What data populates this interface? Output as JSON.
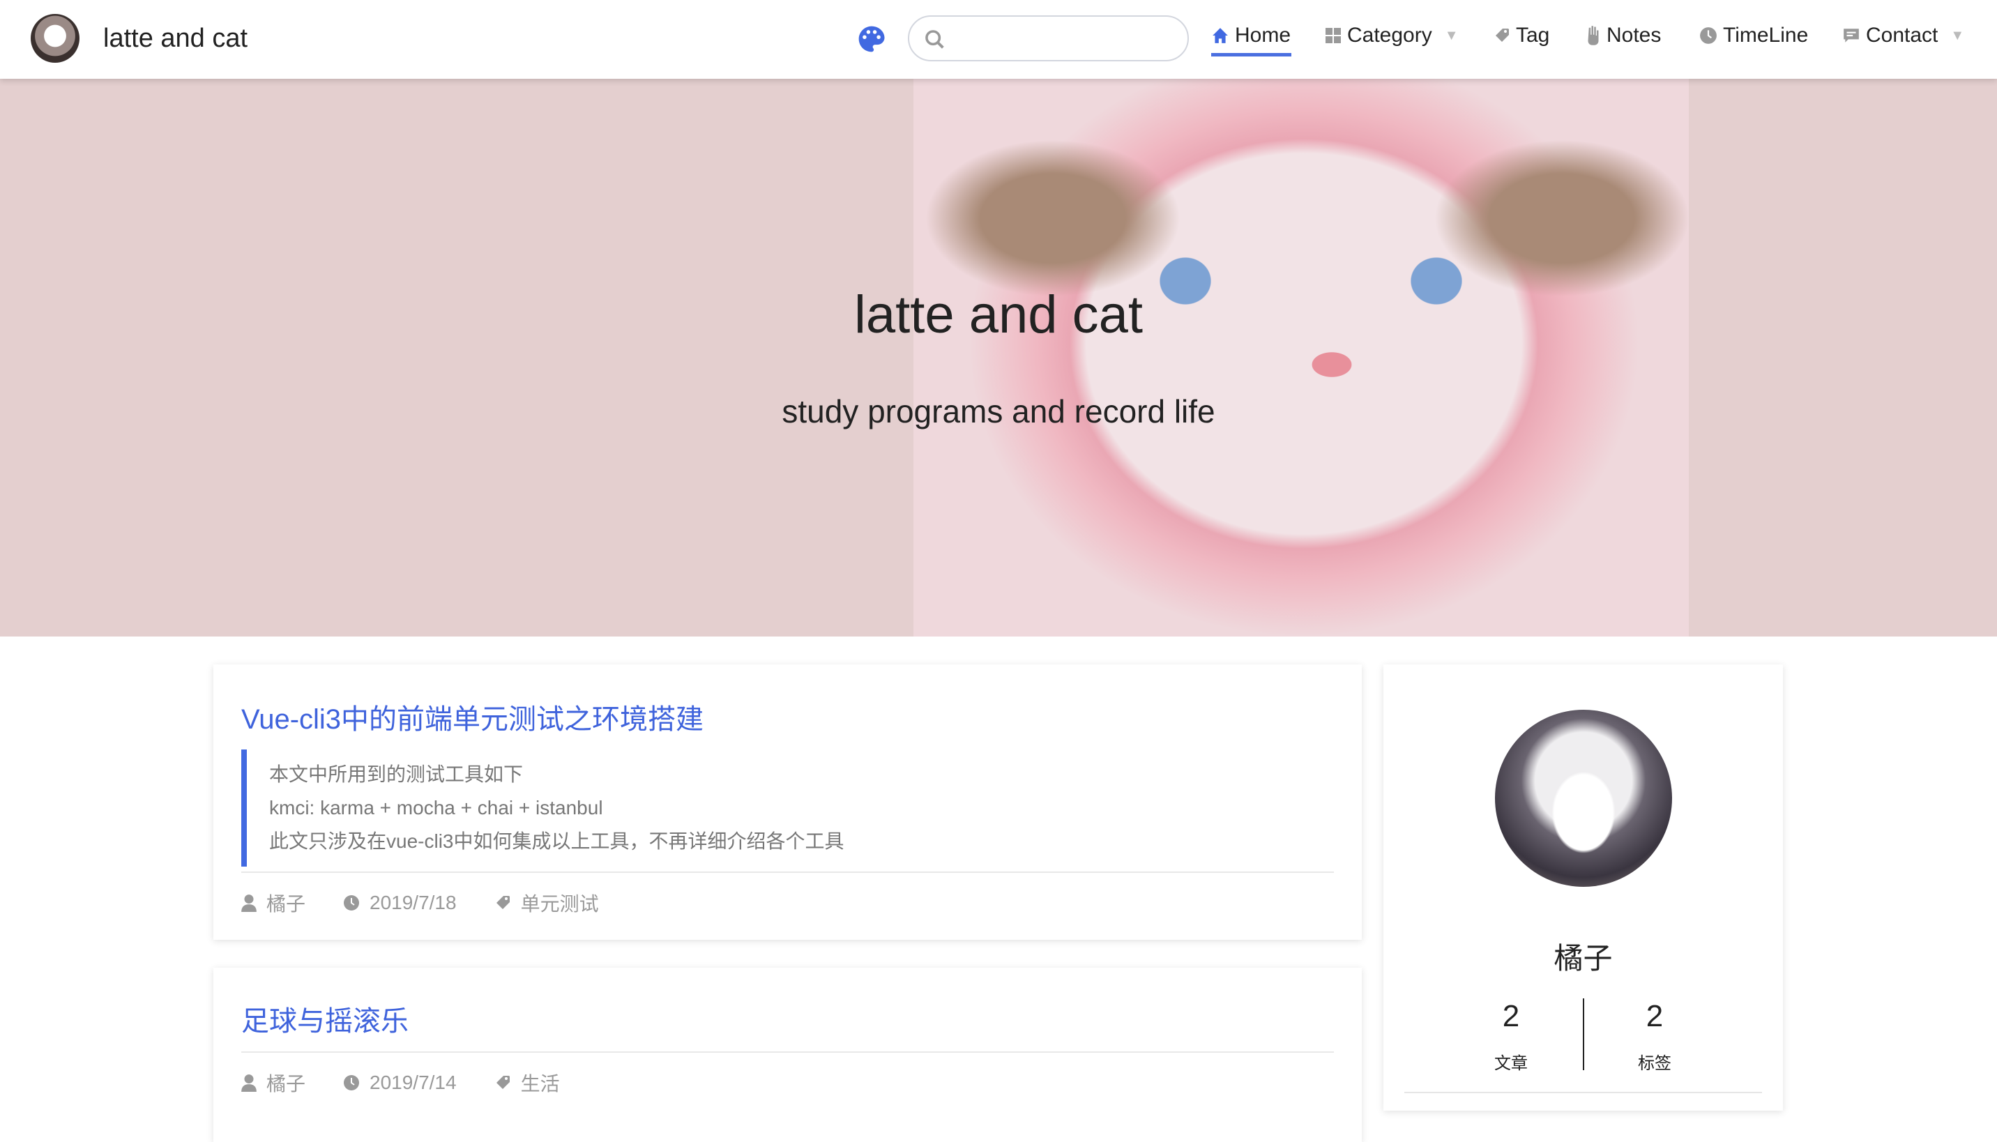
{
  "nav": {
    "site_title": "latte and cat",
    "search_placeholder": "",
    "items": [
      {
        "label": "Home",
        "icon": "home-icon"
      },
      {
        "label": "Category",
        "icon": "grid-icon"
      },
      {
        "label": "Tag",
        "icon": "tag-icon"
      },
      {
        "label": "Notes",
        "icon": "hand-icon"
      },
      {
        "label": "TimeLine",
        "icon": "clock-icon"
      },
      {
        "label": "Contact",
        "icon": "message-icon"
      }
    ],
    "accent": "#4169e1"
  },
  "hero": {
    "title": "latte and cat",
    "subtitle": "study programs and record life"
  },
  "posts": [
    {
      "title": "Vue-cli3中的前端单元测试之环境搭建",
      "excerpt": [
        "本文中所用到的测试工具如下",
        "kmci: karma + mocha + chai + istanbul",
        "此文只涉及在vue-cli3中如何集成以上工具，不再详细介绍各个工具"
      ],
      "author": "橘子",
      "date": "2019/7/18",
      "tag": "单元测试"
    },
    {
      "title": "足球与摇滚乐",
      "author": "橘子",
      "date": "2019/7/14",
      "tag": "生活"
    }
  ],
  "profile": {
    "name": "橘子",
    "stats": [
      {
        "value": "2",
        "label": "文章"
      },
      {
        "value": "2",
        "label": "标签"
      }
    ]
  }
}
